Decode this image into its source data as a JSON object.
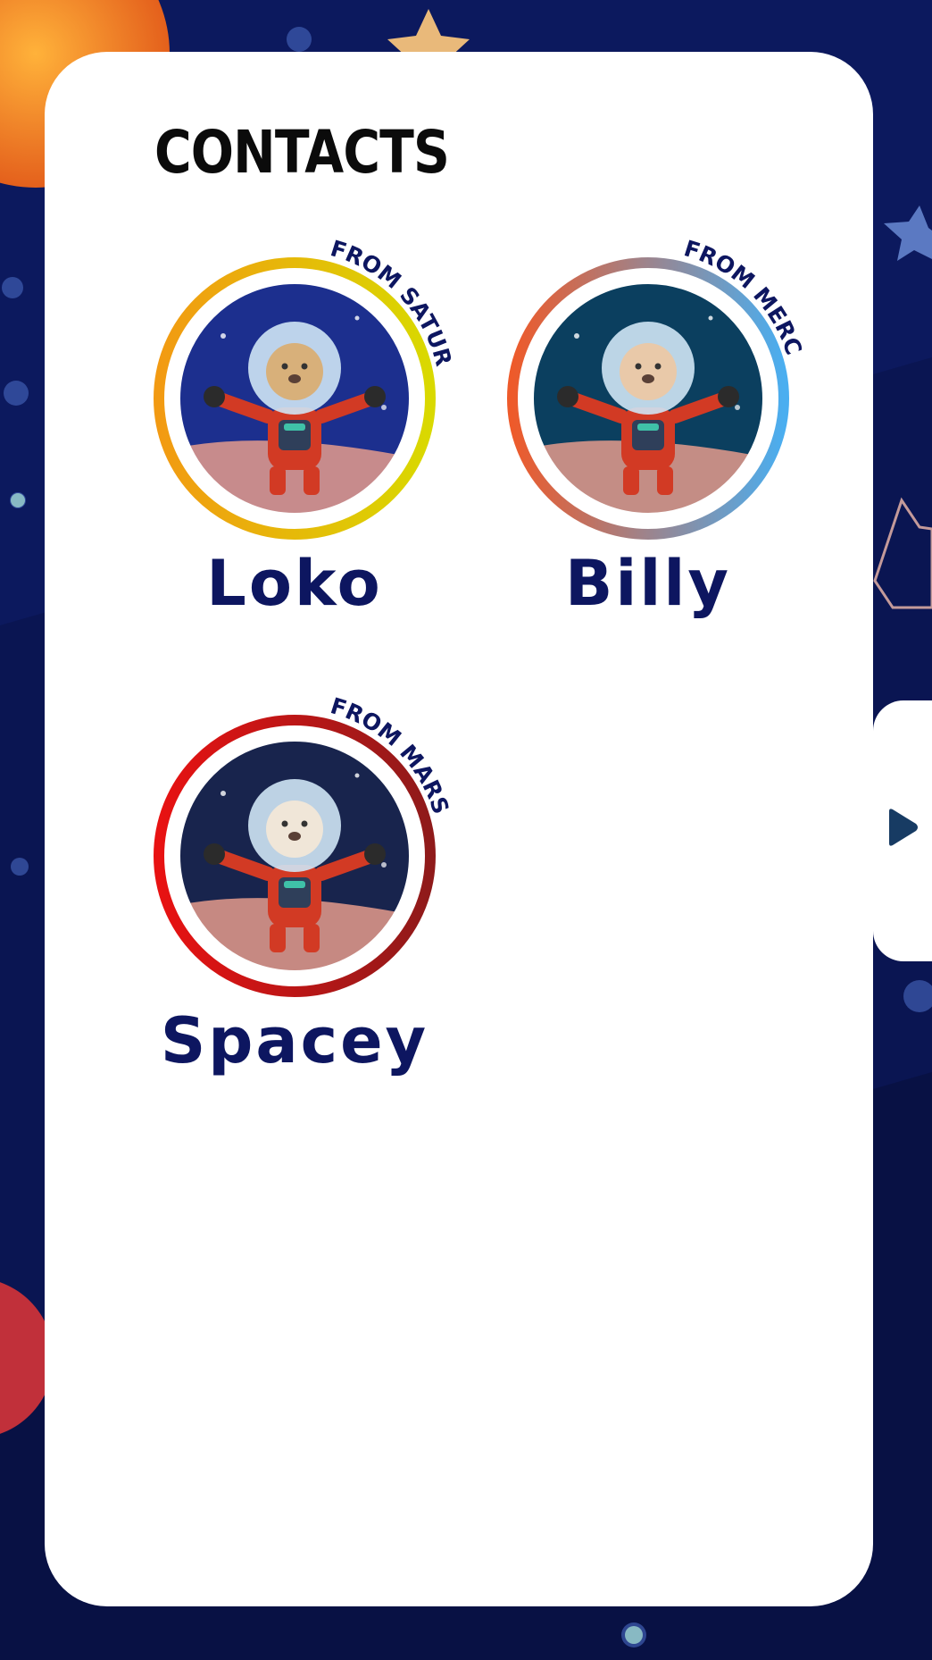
{
  "page": {
    "title": "CONTACTS"
  },
  "contacts": [
    {
      "name": "Loko",
      "origin": "FROM SATURN",
      "ring_colors": [
        "#f29a12",
        "#d9d900"
      ],
      "bg": "#1c2f8e",
      "helmet_color": "#d8b07a"
    },
    {
      "name": "Billy",
      "origin": "FROM MERCURY",
      "ring_colors": [
        "#ee5a2a",
        "#4aaef0"
      ],
      "bg": "#0b3f5f",
      "helmet_color": "#e9c9a9"
    },
    {
      "name": "Spacey",
      "origin": "FROM MARS",
      "ring_colors": [
        "#e81212",
        "#8f1a1a"
      ],
      "bg": "#18244d",
      "helmet_color": "#f0e6d8"
    }
  ],
  "navigation": {
    "next_icon": "play-triangle-icon"
  },
  "colors": {
    "background": "#0a1552",
    "panel": "#ffffff",
    "text_dark": "#0d1660"
  }
}
